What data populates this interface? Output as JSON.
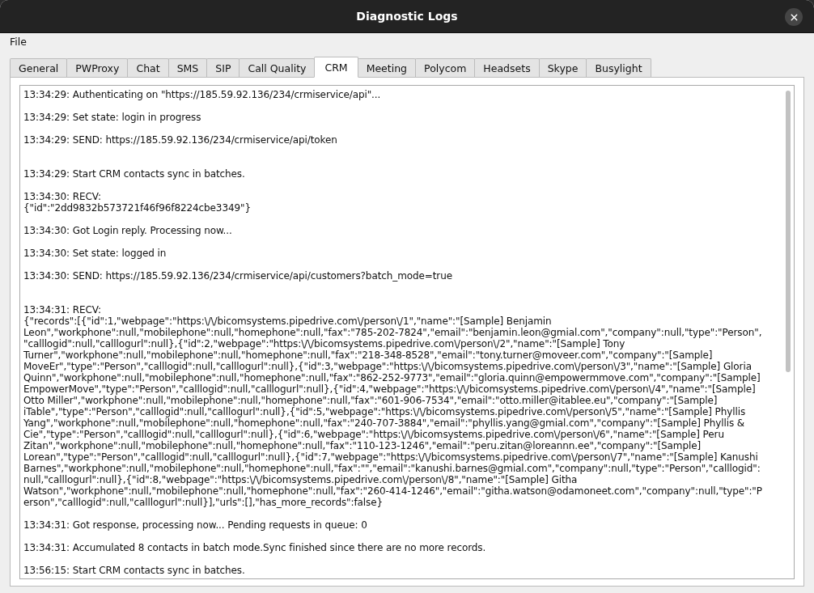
{
  "window": {
    "title": "Diagnostic Logs"
  },
  "menu": [
    {
      "label": "File"
    }
  ],
  "tabs": [
    {
      "label": "General",
      "selected": false
    },
    {
      "label": "PWProxy",
      "selected": false
    },
    {
      "label": "Chat",
      "selected": false
    },
    {
      "label": "SMS",
      "selected": false
    },
    {
      "label": "SIP",
      "selected": false
    },
    {
      "label": "Call Quality",
      "selected": false
    },
    {
      "label": "CRM",
      "selected": true
    },
    {
      "label": "Meeting",
      "selected": false
    },
    {
      "label": "Polycom",
      "selected": false
    },
    {
      "label": "Headsets",
      "selected": false
    },
    {
      "label": "Skype",
      "selected": false
    },
    {
      "label": "Busylight",
      "selected": false
    }
  ],
  "log": [
    {
      "kind": "text",
      "text": "13:34:29: Authenticating on \"https://185.59.92.136/234/crmiservice/api\"..."
    },
    {
      "kind": "text",
      "text": "13:34:29: Set state: login in progress"
    },
    {
      "kind": "text",
      "text": "13:34:29: SEND: https://185.59.92.136/234/crmiservice/api/token"
    },
    {
      "kind": "blank"
    },
    {
      "kind": "text",
      "text": "13:34:29: Start CRM contacts sync in batches."
    },
    {
      "kind": "text",
      "text": "13:34:30: RECV:\n{\"id\":\"2dd9832b573721f46f96f8224cbe3349\"}"
    },
    {
      "kind": "text",
      "text": "13:34:30: Got Login reply. Processing now..."
    },
    {
      "kind": "text",
      "text": "13:34:30: Set state: logged in"
    },
    {
      "kind": "text",
      "text": "13:34:30: SEND: https://185.59.92.136/234/crmiservice/api/customers?batch_mode=true"
    },
    {
      "kind": "blank"
    },
    {
      "kind": "text",
      "text": "13:34:31: RECV:\n{\"records\":[{\"id\":1,\"webpage\":\"https:\\/\\/bicomsystems.pipedrive.com\\/person\\/1\",\"name\":\"[Sample] Benjamin\nLeon\",\"workphone\":null,\"mobilephone\":null,\"homephone\":null,\"fax\":\"785-202-7824\",\"email\":\"benjamin.leon@gmial.com\",\"company\":null,\"type\":\"Person\",\n\"calllogid\":null,\"calllogurl\":null},{\"id\":2,\"webpage\":\"https:\\/\\/bicomsystems.pipedrive.com\\/person\\/2\",\"name\":\"[Sample] Tony\nTurner\",\"workphone\":null,\"mobilephone\":null,\"homephone\":null,\"fax\":\"218-348-8528\",\"email\":\"tony.turner@moveer.com\",\"company\":\"[Sample]\nMoveEr\",\"type\":\"Person\",\"calllogid\":null,\"calllogurl\":null},{\"id\":3,\"webpage\":\"https:\\/\\/bicomsystems.pipedrive.com\\/person\\/3\",\"name\":\"[Sample] Gloria\nQuinn\",\"workphone\":null,\"mobilephone\":null,\"homephone\":null,\"fax\":\"862-252-9773\",\"email\":\"gloria.quinn@empowermmove.com\",\"company\":\"[Sample]\nEmpowerMove\",\"type\":\"Person\",\"calllogid\":null,\"calllogurl\":null},{\"id\":4,\"webpage\":\"https:\\/\\/bicomsystems.pipedrive.com\\/person\\/4\",\"name\":\"[Sample]\nOtto Miller\",\"workphone\":null,\"mobilephone\":null,\"homephone\":null,\"fax\":\"601-906-7534\",\"email\":\"otto.miller@itablee.eu\",\"company\":\"[Sample]\niTable\",\"type\":\"Person\",\"calllogid\":null,\"calllogurl\":null},{\"id\":5,\"webpage\":\"https:\\/\\/bicomsystems.pipedrive.com\\/person\\/5\",\"name\":\"[Sample] Phyllis\nYang\",\"workphone\":null,\"mobilephone\":null,\"homephone\":null,\"fax\":\"240-707-3884\",\"email\":\"phyllis.yang@gmial.com\",\"company\":\"[Sample] Phyllis &\nCie\",\"type\":\"Person\",\"calllogid\":null,\"calllogurl\":null},{\"id\":6,\"webpage\":\"https:\\/\\/bicomsystems.pipedrive.com\\/person\\/6\",\"name\":\"[Sample] Peru\nZitan\",\"workphone\":null,\"mobilephone\":null,\"homephone\":null,\"fax\":\"110-123-1246\",\"email\":\"peru.zitan@loreannn.ee\",\"company\":\"[Sample]\nLorean\",\"type\":\"Person\",\"calllogid\":null,\"calllogurl\":null},{\"id\":7,\"webpage\":\"https:\\/\\/bicomsystems.pipedrive.com\\/person\\/7\",\"name\":\"[Sample] Kanushi\nBarnes\",\"workphone\":null,\"mobilephone\":null,\"homephone\":null,\"fax\":\"\",\"email\":\"kanushi.barnes@gmial.com\",\"company\":null,\"type\":\"Person\",\"calllogid\":\nnull,\"calllogurl\":null},{\"id\":8,\"webpage\":\"https:\\/\\/bicomsystems.pipedrive.com\\/person\\/8\",\"name\":\"[Sample] Githa\nWatson\",\"workphone\":null,\"mobilephone\":null,\"homephone\":null,\"fax\":\"260-414-1246\",\"email\":\"githa.watson@odamoneet.com\",\"company\":null,\"type\":\"P\nerson\",\"calllogid\":null,\"calllogurl\":null}],\"urls\":[],\"has_more_records\":false}"
    },
    {
      "kind": "text",
      "text": "13:34:31: Got response, processing now... Pending requests in queue: 0"
    },
    {
      "kind": "text",
      "text": "13:34:31: Accumulated 8 contacts in batch mode.Sync finished since there are no more records."
    },
    {
      "kind": "text",
      "text": "13:56:15: Start CRM contacts sync in batches."
    }
  ]
}
